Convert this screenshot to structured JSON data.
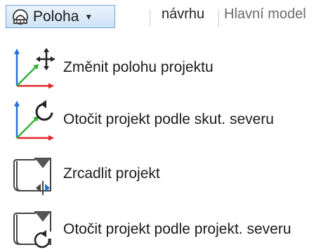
{
  "toolbar": {
    "dropdown_label": "Poloha",
    "dropdown_icon": "compass-icon",
    "caret_icon": "chevron-down-icon",
    "tab_design": "návrhu",
    "tab_main_model": "Hlavní model"
  },
  "menu": {
    "items": [
      {
        "label": "Změnit polohu projektu",
        "icon": "relocate-project-icon"
      },
      {
        "label": "Otočit projekt podle skut. severu",
        "icon": "rotate-true-north-icon"
      },
      {
        "label": "Zrcadlit projekt",
        "icon": "mirror-project-icon"
      },
      {
        "label": "Otočit projekt podle projekt. severu",
        "icon": "rotate-project-north-icon"
      }
    ]
  },
  "colors": {
    "axis_x": "#e0262b",
    "axis_y": "#2a6fd6",
    "axis_z": "#33b23a",
    "button_border": "#6fa6d6"
  }
}
